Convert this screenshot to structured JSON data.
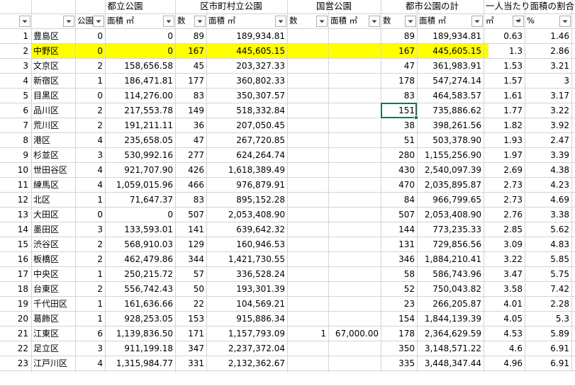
{
  "group_headers": {
    "metro_park": "都立公園",
    "municipal_park": "区市町村立公園",
    "national_park": "国営公園",
    "city_park_total": "都市公園の計",
    "per_capita": "一人当たり面積の割合"
  },
  "column_headers": {
    "metro_count": "公園",
    "metro_area": "面積 ㎡",
    "muni_count": "数",
    "muni_area": "面積 ㎡",
    "nat_count": "数",
    "nat_area": "面積 ㎡",
    "total_count": "数",
    "total_area": "面積 ㎡",
    "per_capita_area": "㎡",
    "ratio": "%"
  },
  "rows": [
    {
      "n": "1",
      "ward": "豊島区",
      "mc": "0",
      "ma": "0",
      "uc": "89",
      "ua": "189,934.81",
      "nc": "",
      "na": "",
      "tc": "89",
      "ta": "189,934.81",
      "pc": "0.63",
      "pct": "1.46"
    },
    {
      "n": "2",
      "ward": "中野区",
      "mc": "0",
      "ma": "0",
      "uc": "167",
      "ua": "445,605.15",
      "nc": "",
      "na": "",
      "tc": "167",
      "ta": "445,605.15",
      "pc": "1.3",
      "pct": "2.86"
    },
    {
      "n": "3",
      "ward": "文京区",
      "mc": "2",
      "ma": "158,656.58",
      "uc": "45",
      "ua": "203,327.33",
      "nc": "",
      "na": "",
      "tc": "47",
      "ta": "361,983.91",
      "pc": "1.53",
      "pct": "3.21"
    },
    {
      "n": "4",
      "ward": "新宿区",
      "mc": "1",
      "ma": "186,471.81",
      "uc": "177",
      "ua": "360,802.33",
      "nc": "",
      "na": "",
      "tc": "178",
      "ta": "547,274.14",
      "pc": "1.57",
      "pct": "3"
    },
    {
      "n": "5",
      "ward": "目黒区",
      "mc": "0",
      "ma": "114,276.00",
      "uc": "83",
      "ua": "350,307.57",
      "nc": "",
      "na": "",
      "tc": "83",
      "ta": "464,583.57",
      "pc": "1.61",
      "pct": "3.17"
    },
    {
      "n": "6",
      "ward": "品川区",
      "mc": "2",
      "ma": "217,553.78",
      "uc": "149",
      "ua": "518,332.84",
      "nc": "",
      "na": "",
      "tc": "151",
      "ta": "735,886.62",
      "pc": "1.77",
      "pct": "3.22"
    },
    {
      "n": "7",
      "ward": "荒川区",
      "mc": "2",
      "ma": "191,211.11",
      "uc": "36",
      "ua": "207,050.45",
      "nc": "",
      "na": "",
      "tc": "38",
      "ta": "398,261.56",
      "pc": "1.82",
      "pct": "3.92"
    },
    {
      "n": "8",
      "ward": "港区",
      "mc": "4",
      "ma": "235,658.05",
      "uc": "47",
      "ua": "267,720.85",
      "nc": "",
      "na": "",
      "tc": "51",
      "ta": "503,378.90",
      "pc": "1.93",
      "pct": "2.47"
    },
    {
      "n": "9",
      "ward": "杉並区",
      "mc": "3",
      "ma": "530,992.16",
      "uc": "277",
      "ua": "624,264.74",
      "nc": "",
      "na": "",
      "tc": "280",
      "ta": "1,155,256.90",
      "pc": "1.97",
      "pct": "3.39"
    },
    {
      "n": "10",
      "ward": "世田谷区",
      "mc": "4",
      "ma": "921,707.90",
      "uc": "426",
      "ua": "1,618,389.49",
      "nc": "",
      "na": "",
      "tc": "430",
      "ta": "2,540,097.39",
      "pc": "2.69",
      "pct": "4.38"
    },
    {
      "n": "11",
      "ward": "練馬区",
      "mc": "4",
      "ma": "1,059,015.96",
      "uc": "466",
      "ua": "976,879.91",
      "nc": "",
      "na": "",
      "tc": "470",
      "ta": "2,035,895.87",
      "pc": "2.73",
      "pct": "4.23"
    },
    {
      "n": "12",
      "ward": "北区",
      "mc": "1",
      "ma": "71,647.37",
      "uc": "83",
      "ua": "895,152.28",
      "nc": "",
      "na": "",
      "tc": "84",
      "ta": "966,799.65",
      "pc": "2.73",
      "pct": "4.69"
    },
    {
      "n": "13",
      "ward": "大田区",
      "mc": "0",
      "ma": "0",
      "uc": "507",
      "ua": "2,053,408.90",
      "nc": "",
      "na": "",
      "tc": "507",
      "ta": "2,053,408.90",
      "pc": "2.76",
      "pct": "3.38"
    },
    {
      "n": "14",
      "ward": "墨田区",
      "mc": "3",
      "ma": "133,593.01",
      "uc": "141",
      "ua": "639,642.32",
      "nc": "",
      "na": "",
      "tc": "144",
      "ta": "773,235.33",
      "pc": "2.85",
      "pct": "5.62"
    },
    {
      "n": "15",
      "ward": "渋谷区",
      "mc": "2",
      "ma": "568,910.03",
      "uc": "129",
      "ua": "160,946.53",
      "nc": "",
      "na": "",
      "tc": "131",
      "ta": "729,856.56",
      "pc": "3.09",
      "pct": "4.83"
    },
    {
      "n": "16",
      "ward": "板橋区",
      "mc": "2",
      "ma": "462,479.86",
      "uc": "344",
      "ua": "1,421,730.55",
      "nc": "",
      "na": "",
      "tc": "346",
      "ta": "1,884,210.41",
      "pc": "3.22",
      "pct": "5.85"
    },
    {
      "n": "17",
      "ward": "中央区",
      "mc": "1",
      "ma": "250,215.72",
      "uc": "57",
      "ua": "336,528.24",
      "nc": "",
      "na": "",
      "tc": "58",
      "ta": "586,743.96",
      "pc": "3.47",
      "pct": "5.75"
    },
    {
      "n": "18",
      "ward": "台東区",
      "mc": "2",
      "ma": "556,742.43",
      "uc": "50",
      "ua": "193,301.39",
      "nc": "",
      "na": "",
      "tc": "52",
      "ta": "750,043.82",
      "pc": "3.58",
      "pct": "7.42"
    },
    {
      "n": "19",
      "ward": "千代田区",
      "mc": "1",
      "ma": "161,636.66",
      "uc": "22",
      "ua": "104,569.21",
      "nc": "",
      "na": "",
      "tc": "23",
      "ta": "266,205.87",
      "pc": "4.01",
      "pct": "2.28"
    },
    {
      "n": "20",
      "ward": "葛飾区",
      "mc": "1",
      "ma": "928,253.05",
      "uc": "153",
      "ua": "915,886.34",
      "nc": "",
      "na": "",
      "tc": "154",
      "ta": "1,844,139.39",
      "pc": "4.05",
      "pct": "5.3"
    },
    {
      "n": "21",
      "ward": "江東区",
      "mc": "6",
      "ma": "1,139,836.50",
      "uc": "171",
      "ua": "1,157,793.09",
      "nc": "1",
      "na": "67,000.00",
      "tc": "178",
      "ta": "2,364,629.59",
      "pc": "4.53",
      "pct": "5.89"
    },
    {
      "n": "22",
      "ward": "足立区",
      "mc": "3",
      "ma": "911,199.18",
      "uc": "347",
      "ua": "2,237,372.04",
      "nc": "",
      "na": "",
      "tc": "350",
      "ta": "3,148,571.22",
      "pc": "4.6",
      "pct": "6.91"
    },
    {
      "n": "23",
      "ward": "江戸川区",
      "mc": "4",
      "ma": "1,315,984.77",
      "uc": "331",
      "ua": "2,132,362.67",
      "nc": "",
      "na": "",
      "tc": "335",
      "ta": "3,448,347.44",
      "pc": "4.96",
      "pct": "6.91"
    }
  ],
  "highlight_row": "2",
  "selected_cell": {
    "row": "6",
    "column": "total_count"
  },
  "colors": {
    "highlight": "#ffff00",
    "selection": "#217346",
    "gridline": "#d4d4d4"
  },
  "icons": {
    "filter": "filter-dropdown-icon",
    "sort": "sort-ascending-filter-icon"
  }
}
